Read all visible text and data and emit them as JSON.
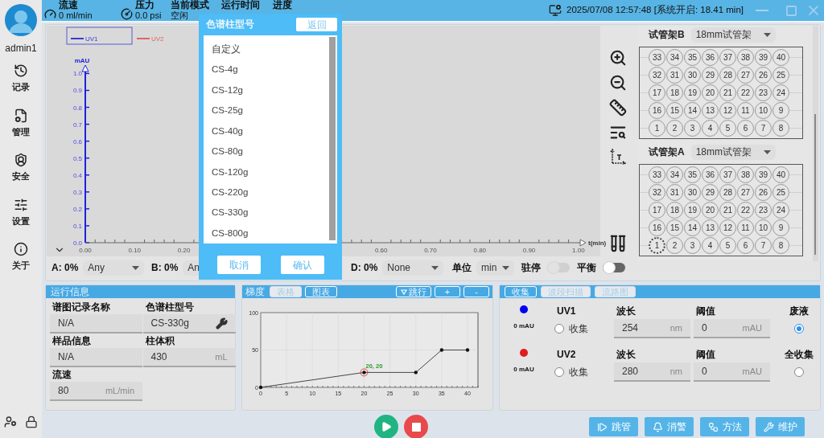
{
  "sidebar": {
    "user": "admin1",
    "items": [
      {
        "label": "记录"
      },
      {
        "label": "管理"
      },
      {
        "label": "安全"
      },
      {
        "label": "设置"
      },
      {
        "label": "关于"
      }
    ]
  },
  "status": [
    {
      "label": "流速",
      "value": "0 ml/min"
    },
    {
      "label": "压力",
      "value": "0.0 psi"
    },
    {
      "label": "当前模式",
      "value": "空闲"
    },
    {
      "label": "运行时间"
    },
    {
      "label": "进度"
    }
  ],
  "datetime": "2025/07/08 12:57:48 [系统开启: 18.41 min]",
  "chart": {
    "legend": [
      {
        "name": "UV1",
        "color": "#3a3ad8",
        "selected": true
      },
      {
        "name": "UV2",
        "color": "#e06464",
        "selected": false
      }
    ],
    "chart_data": {
      "type": "line",
      "xlabel": "t(min)",
      "ylabel": "mAU",
      "xlim": [
        0,
        1.015
      ],
      "ylim": [
        0,
        1.04
      ],
      "xticks": [
        {
          "value": 0,
          "label": "0.00"
        },
        {
          "value": 0.1,
          "label": "0.10"
        },
        {
          "value": 0.2,
          "label": "0.20"
        },
        {
          "value": 0.6,
          "label": "0.60"
        },
        {
          "value": 0.7,
          "label": "0.70"
        },
        {
          "value": 0.8,
          "label": "0.80"
        },
        {
          "value": 0.9,
          "label": "0.90"
        },
        {
          "value": 1,
          "label": "1.00"
        }
      ],
      "yticks": [
        {
          "value": 0,
          "label": "0.0"
        },
        {
          "value": 0.1,
          "label": "0.1"
        },
        {
          "value": 0.2,
          "label": "0.2"
        },
        {
          "value": 0.3,
          "label": "0.3"
        },
        {
          "value": 0.4,
          "label": "0.4"
        },
        {
          "value": 0.5,
          "label": "0.5"
        },
        {
          "value": 0.6,
          "label": "0.6"
        },
        {
          "value": 0.7,
          "label": "0.7"
        },
        {
          "value": 0.8,
          "label": "0.8"
        },
        {
          "value": 0.9,
          "label": "0.9"
        },
        {
          "value": 1,
          "label": "1.0"
        }
      ]
    }
  },
  "racks": [
    {
      "title": "试管架B",
      "type": "18mm试管架",
      "rows": [
        [
          {
            "label": "33",
            "selected": false
          },
          {
            "label": "34",
            "selected": false
          },
          {
            "label": "35",
            "selected": false
          },
          {
            "label": "36",
            "selected": false
          },
          {
            "label": "37",
            "selected": false
          },
          {
            "label": "38",
            "selected": false
          },
          {
            "label": "39",
            "selected": false
          },
          {
            "label": "40",
            "selected": false
          }
        ],
        [
          {
            "label": "32",
            "selected": false
          },
          {
            "label": "31",
            "selected": false
          },
          {
            "label": "30",
            "selected": false
          },
          {
            "label": "29",
            "selected": false
          },
          {
            "label": "28",
            "selected": false
          },
          {
            "label": "27",
            "selected": false
          },
          {
            "label": "26",
            "selected": false
          },
          {
            "label": "25",
            "selected": false
          }
        ],
        [
          {
            "label": "17",
            "selected": false
          },
          {
            "label": "18",
            "selected": false
          },
          {
            "label": "19",
            "selected": false
          },
          {
            "label": "20",
            "selected": false
          },
          {
            "label": "21",
            "selected": false
          },
          {
            "label": "22",
            "selected": false
          },
          {
            "label": "23",
            "selected": false
          },
          {
            "label": "24",
            "selected": false
          }
        ],
        [
          {
            "label": "16",
            "selected": false
          },
          {
            "label": "15",
            "selected": false
          },
          {
            "label": "14",
            "selected": false
          },
          {
            "label": "13",
            "selected": false
          },
          {
            "label": "12",
            "selected": false
          },
          {
            "label": "11",
            "selected": false
          },
          {
            "label": "10",
            "selected": false
          },
          {
            "label": "9",
            "selected": false
          }
        ],
        [
          {
            "label": "1",
            "selected": false
          },
          {
            "label": "2",
            "selected": false
          },
          {
            "label": "3",
            "selected": false
          },
          {
            "label": "4",
            "selected": false
          },
          {
            "label": "5",
            "selected": false
          },
          {
            "label": "6",
            "selected": false
          },
          {
            "label": "7",
            "selected": false
          },
          {
            "label": "8",
            "selected": false
          }
        ]
      ]
    },
    {
      "title": "试管架A",
      "type": "18mm试管架",
      "rows": [
        [
          {
            "label": "33",
            "selected": false
          },
          {
            "label": "34",
            "selected": false
          },
          {
            "label": "35",
            "selected": false
          },
          {
            "label": "36",
            "selected": false
          },
          {
            "label": "37",
            "selected": false
          },
          {
            "label": "38",
            "selected": false
          },
          {
            "label": "39",
            "selected": false
          },
          {
            "label": "40",
            "selected": false
          }
        ],
        [
          {
            "label": "32",
            "selected": false
          },
          {
            "label": "31",
            "selected": false
          },
          {
            "label": "30",
            "selected": false
          },
          {
            "label": "29",
            "selected": false
          },
          {
            "label": "28",
            "selected": false
          },
          {
            "label": "27",
            "selected": false
          },
          {
            "label": "26",
            "selected": false
          },
          {
            "label": "25",
            "selected": false
          }
        ],
        [
          {
            "label": "17",
            "selected": false
          },
          {
            "label": "18",
            "selected": false
          },
          {
            "label": "19",
            "selected": false
          },
          {
            "label": "20",
            "selected": false
          },
          {
            "label": "21",
            "selected": false
          },
          {
            "label": "22",
            "selected": false
          },
          {
            "label": "23",
            "selected": false
          },
          {
            "label": "24",
            "selected": false
          }
        ],
        [
          {
            "label": "16",
            "selected": false
          },
          {
            "label": "15",
            "selected": false
          },
          {
            "label": "14",
            "selected": false
          },
          {
            "label": "13",
            "selected": false
          },
          {
            "label": "12",
            "selected": false
          },
          {
            "label": "11",
            "selected": false
          },
          {
            "label": "10",
            "selected": false
          },
          {
            "label": "9",
            "selected": false
          }
        ],
        [
          {
            "label": "1",
            "selected": true
          },
          {
            "label": "2",
            "selected": false
          },
          {
            "label": "3",
            "selected": false
          },
          {
            "label": "4",
            "selected": false
          },
          {
            "label": "5",
            "selected": false
          },
          {
            "label": "6",
            "selected": false
          },
          {
            "label": "7",
            "selected": false
          },
          {
            "label": "8",
            "selected": false
          }
        ]
      ]
    }
  ],
  "solvents": [
    {
      "label": "A: 0%",
      "value": "Any"
    },
    {
      "label": "B: 0%",
      "value": "An"
    },
    {
      "label": "D: 0%",
      "value": "None"
    }
  ],
  "unit": {
    "label": "单位",
    "value": "min"
  },
  "toggles": [
    {
      "label": "驻停",
      "on": false,
      "disabled": true
    },
    {
      "label": "平衡",
      "on": false,
      "disabled": false
    }
  ],
  "run_info": {
    "title": "运行信息",
    "fields": [
      {
        "label": "谱图记录名称",
        "value": "N/A",
        "kind": "plain"
      },
      {
        "label": "色谱柱型号",
        "value": "CS-330g",
        "kind": "tool"
      },
      {
        "label": "样品信息",
        "value": "N/A",
        "kind": "plain"
      },
      {
        "label": "柱体积",
        "value": "430",
        "unit": "mL",
        "kind": "unit"
      },
      {
        "label": "流速",
        "value": "80",
        "unit": "mL/min",
        "kind": "unit"
      }
    ]
  },
  "gradient": {
    "title": "梯度",
    "tabs": [
      {
        "label": "表格",
        "selected": false
      },
      {
        "label": "图表",
        "selected": true
      }
    ],
    "actions": [
      {
        "label": "跳行",
        "kind": "skip"
      },
      {
        "label": "+",
        "kind": "plain"
      },
      {
        "label": "-",
        "kind": "plain"
      }
    ],
    "chart_data": {
      "type": "line",
      "grid": true,
      "x": [
        0,
        20,
        30,
        35,
        40
      ],
      "series": [
        {
          "color": "#333333",
          "values": [
            0,
            20,
            20,
            50,
            50
          ]
        }
      ],
      "xlim": [
        0,
        40
      ],
      "ylim": [
        0,
        100
      ],
      "xticks": [
        0,
        5,
        10,
        15,
        20,
        25,
        30,
        35,
        40
      ],
      "yticks": [
        0,
        50,
        100
      ],
      "annotations": [
        {
          "x": 20,
          "y": 20,
          "text": "20, 20"
        }
      ]
    }
  },
  "collection": {
    "tabs": [
      {
        "label": "收集",
        "selected": true
      },
      {
        "label": "波段扫描",
        "selected": false
      },
      {
        "label": "流路图",
        "selected": false
      }
    ],
    "channels": [
      {
        "name": "UV1",
        "color": "#0000ee",
        "reading": "0 mAU",
        "collect": {
          "label": "收集",
          "checked": false
        },
        "wavelength": {
          "label": "波长",
          "value": "254",
          "unit": "nm"
        },
        "threshold": {
          "label": "阈值",
          "value": "0",
          "unit": "mAU"
        },
        "mode": {
          "label": "废液",
          "selected": true
        }
      },
      {
        "name": "UV2",
        "color": "#e01c1c",
        "reading": "0 mAU",
        "collect": {
          "label": "收集",
          "checked": false
        },
        "wavelength": {
          "label": "波长",
          "value": "280",
          "unit": "nm"
        },
        "threshold": {
          "label": "阈值",
          "value": "0",
          "unit": "mAU"
        },
        "mode": {
          "label": "全收集",
          "selected": false
        }
      }
    ]
  },
  "actions": [
    {
      "label": "跳管"
    },
    {
      "label": "消警"
    },
    {
      "label": "方法"
    },
    {
      "label": "维护"
    }
  ],
  "dialog": {
    "title": "色谱柱型号",
    "back": "返回",
    "options": [
      "自定义",
      "CS-4g",
      "CS-12g",
      "CS-25g",
      "CS-40g",
      "CS-80g",
      "CS-120g",
      "CS-220g",
      "CS-330g",
      "CS-800g"
    ],
    "buttons": [
      "取消",
      "确认"
    ]
  }
}
